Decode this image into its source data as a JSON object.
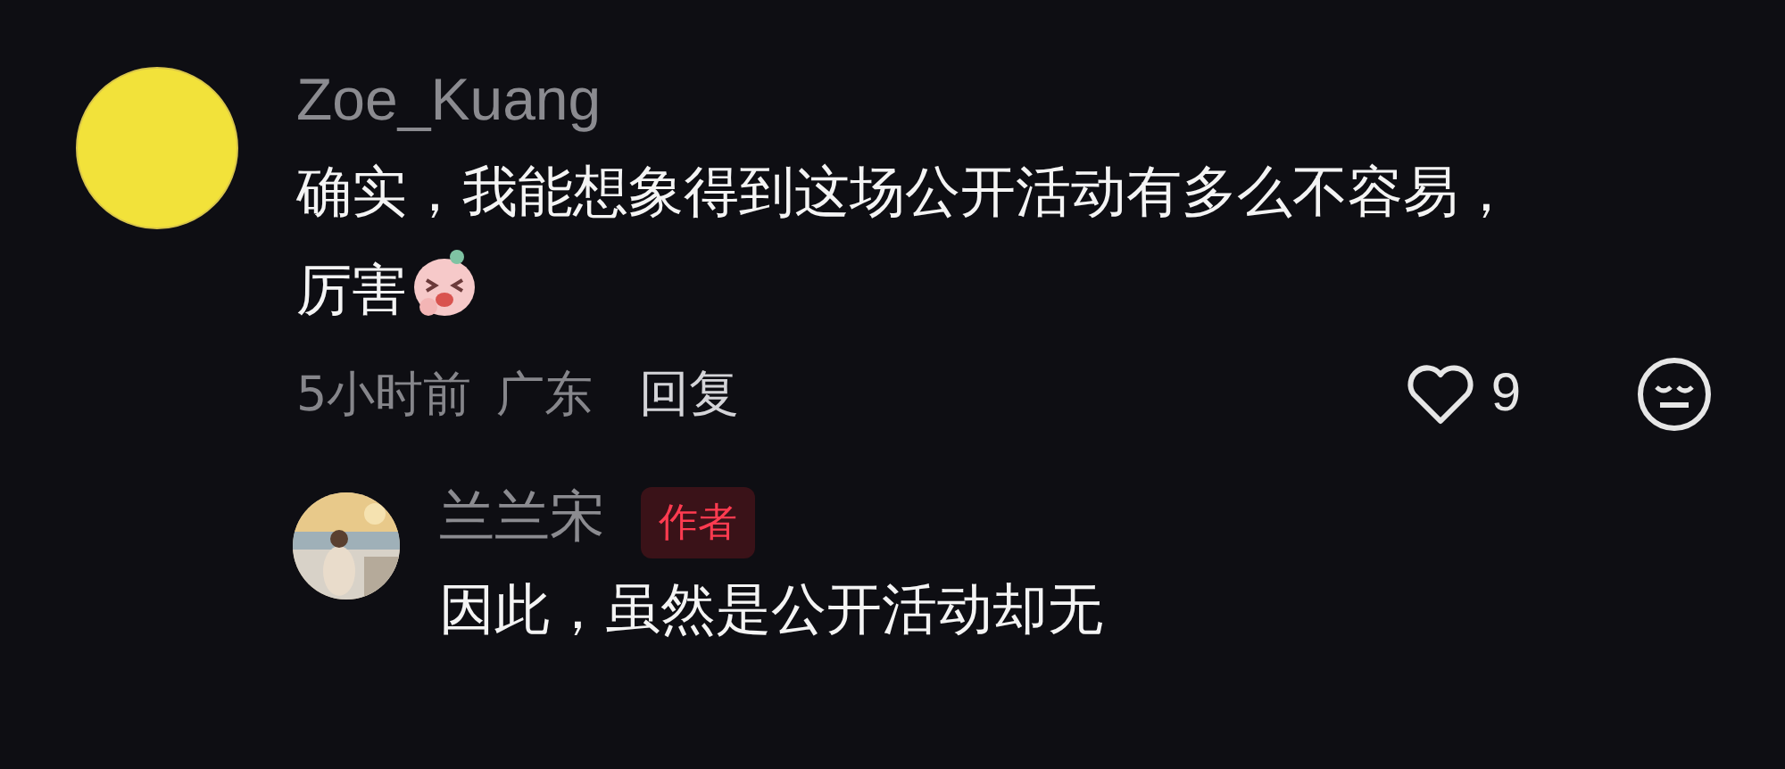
{
  "comments": [
    {
      "author": "Zoe_Kuang",
      "text": "确实，我能想象得到这场公开活动有多么不容易，厉害",
      "has_sticker": true,
      "time": "5小时前",
      "location": "广东",
      "reply_label": "回复",
      "likes": "9",
      "liked": false,
      "replies": [
        {
          "author": "兰兰宋",
          "badge": "作者",
          "text": "因此，虽然是公开活动却无"
        }
      ]
    }
  ]
}
